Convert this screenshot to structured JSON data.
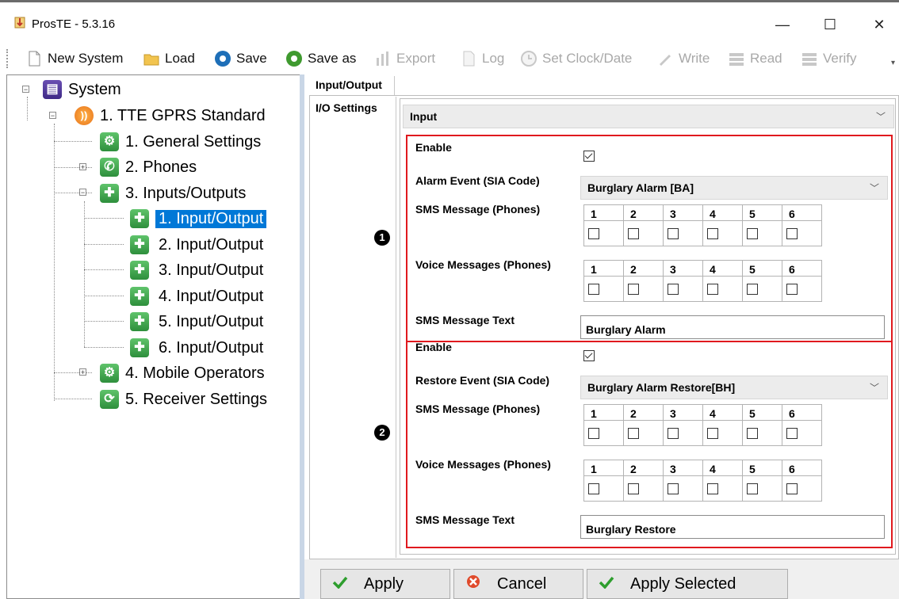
{
  "window": {
    "title": "ProsTE - 5.3.16",
    "minimize": "—",
    "maximize": "☐",
    "close": "✕"
  },
  "toolbar": {
    "new_system": "New System",
    "load": "Load",
    "save": "Save",
    "save_as": "Save as",
    "export": "Export",
    "log": "Log",
    "set_clock": "Set Clock/Date",
    "write": "Write",
    "read": "Read",
    "verify": "Verify",
    "more": "▾"
  },
  "tree": {
    "root": "System",
    "device": "1. TTE GPRS Standard",
    "general": "1. General Settings",
    "phones": "2. Phones",
    "inputs_outputs": "3. Inputs/Outputs",
    "io_items": [
      "1. Input/Output",
      "2. Input/Output",
      "3. Input/Output",
      "4. Input/Output",
      "5. Input/Output",
      "6. Input/Output"
    ],
    "mobile_operators": "4. Mobile Operators",
    "receiver_settings": "5. Receiver Settings"
  },
  "tabs": {
    "main": "Input/Output",
    "side": "I/O Settings"
  },
  "mode_select": "Input",
  "section1": {
    "marker": "1",
    "enable_label": "Enable",
    "enable_checked": true,
    "event_label": "Alarm Event (SIA Code)",
    "event_value": "Burglary Alarm [BA]",
    "sms_label": "SMS Message (Phones)",
    "voice_label": "Voice Messages (Phones)",
    "phones": [
      "1",
      "2",
      "3",
      "4",
      "5",
      "6"
    ],
    "text_label": "SMS Message Text",
    "text_value": "Burglary Alarm"
  },
  "section2": {
    "marker": "2",
    "enable_label": "Enable",
    "enable_checked": true,
    "event_label": "Restore Event (SIA Code)",
    "event_value": "Burglary Alarm Restore[BH]",
    "sms_label": "SMS Message (Phones)",
    "voice_label": "Voice Messages (Phones)",
    "phones": [
      "1",
      "2",
      "3",
      "4",
      "5",
      "6"
    ],
    "text_label": "SMS Message Text",
    "text_value": "Burglary Restore"
  },
  "buttons": {
    "apply": "Apply",
    "cancel": "Cancel",
    "apply_selected": "Apply Selected"
  },
  "colors": {
    "highlight_border": "#e0191e",
    "tree_selection": "#0078d7",
    "icon_green": "#3fa64c"
  }
}
